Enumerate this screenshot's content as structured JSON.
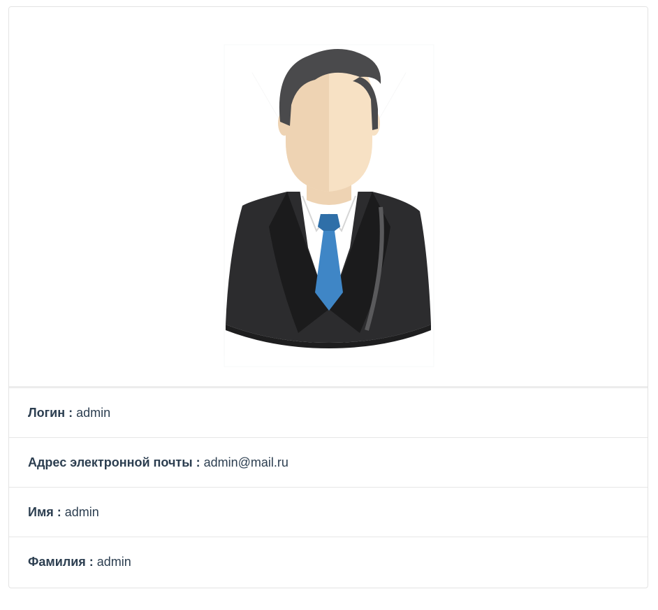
{
  "profile": {
    "avatar_icon": "businessman-avatar-icon",
    "separator": ":",
    "fields": [
      {
        "label": "Логин",
        "value": "admin"
      },
      {
        "label": "Адрес электронной почты",
        "value": "admin@mail.ru"
      },
      {
        "label": "Имя",
        "value": "admin"
      },
      {
        "label": "Фамилия",
        "value": "admin"
      }
    ]
  },
  "colors": {
    "hair": "#4a4a4c",
    "skin_light": "#f7e1c4",
    "skin_dark": "#eed3b3",
    "suit": "#2c2c2e",
    "tie": "#3f86c6",
    "text": "#2c3e50"
  }
}
